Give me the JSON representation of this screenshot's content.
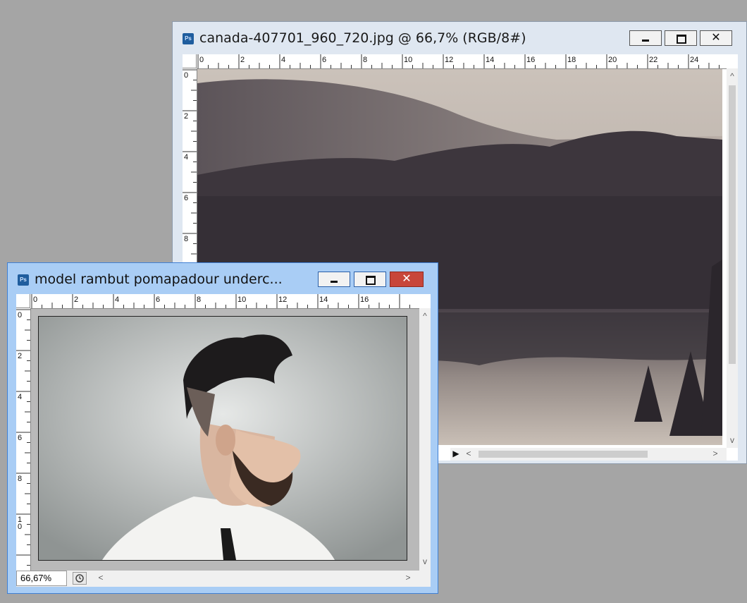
{
  "windows": {
    "back": {
      "title": "canada-407701_960_720.jpg @ 66,7% (RGB/8#)",
      "icon": "ps-icon",
      "ruler_h_labels": [
        "0",
        "2",
        "4",
        "6",
        "8",
        "10",
        "12",
        "14",
        "16",
        "18",
        "20",
        "22",
        "24"
      ],
      "ruler_v_labels": [
        "0",
        "2",
        "4",
        "6",
        "8"
      ]
    },
    "front": {
      "title": "model rambut pomapadour underc...",
      "icon": "ps-icon",
      "ruler_h_labels": [
        "0",
        "2",
        "4",
        "6",
        "8",
        "10",
        "12",
        "14",
        "16"
      ],
      "ruler_v_labels": [
        "0",
        "2",
        "4",
        "6",
        "8",
        "1\n0"
      ],
      "zoom": "66,67%"
    }
  },
  "buttons": {
    "minimize": "▁",
    "maximize": "☐",
    "close": "✕"
  },
  "icon_glyphs": {
    "ps": "Ps",
    "arrow_up": "^",
    "arrow_down": "v",
    "arrow_left": "<",
    "arrow_right": ">",
    "play": "▶"
  }
}
